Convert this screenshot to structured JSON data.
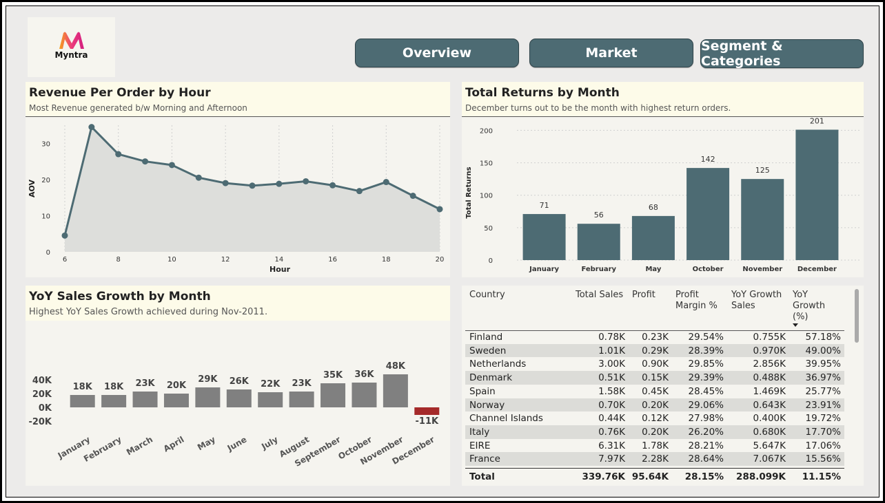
{
  "brand": {
    "name": "Myntra"
  },
  "nav": {
    "overview": "Overview",
    "market": "Market",
    "segment": "Segment & Categories"
  },
  "revenue_panel": {
    "title": "Revenue Per Order by Hour",
    "subtitle": "Most Revenue generated b/w Morning and Afternoon"
  },
  "returns_panel": {
    "title": "Total Returns by Month",
    "subtitle": "December turns  out to be the month with highest return orders."
  },
  "yoy_panel": {
    "title": "YoY Sales Growth by Month",
    "subtitle": "Highest YoY Sales Growth achieved during Nov-2011."
  },
  "chart_data": [
    {
      "type": "area",
      "title": "Revenue Per Order by Hour",
      "xlabel": "Hour",
      "ylabel": "AOV",
      "x": [
        6,
        7,
        8,
        9,
        10,
        11,
        12,
        13,
        14,
        15,
        16,
        17,
        18,
        19,
        20
      ],
      "values": [
        4.5,
        34.5,
        27,
        25,
        24,
        20.5,
        19,
        18.3,
        18.8,
        19.5,
        18.4,
        16.8,
        19.3,
        15.5,
        11.8
      ],
      "xticks": [
        6,
        8,
        10,
        12,
        14,
        16,
        18,
        20
      ],
      "yticks": [
        0,
        10,
        20,
        30
      ],
      "ylim": [
        0,
        35
      ],
      "xlim": [
        6,
        20
      ],
      "color": "#4d6b73"
    },
    {
      "type": "bar",
      "title": "Total Returns by Month",
      "ylabel": "Total Returns",
      "categories": [
        "January",
        "February",
        "May",
        "October",
        "November",
        "December"
      ],
      "values": [
        71,
        56,
        68,
        142,
        125,
        201
      ],
      "yticks": [
        0,
        50,
        100,
        150,
        200
      ],
      "ylim": [
        0,
        210
      ],
      "color": "#4d6b73"
    },
    {
      "type": "bar",
      "title": "YoY Sales Growth by Month",
      "categories": [
        "January",
        "February",
        "March",
        "April",
        "May",
        "June",
        "July",
        "August",
        "September",
        "October",
        "November",
        "December"
      ],
      "values": [
        18,
        18,
        23,
        20,
        29,
        26,
        22,
        23,
        35,
        36,
        48,
        -11
      ],
      "labels": [
        "18K",
        "18K",
        "23K",
        "20K",
        "29K",
        "26K",
        "22K",
        "23K",
        "35K",
        "36K",
        "48K",
        "-11K"
      ],
      "yticks": [
        "40K",
        "20K",
        "0K",
        "-20K"
      ],
      "ytick_values": [
        40,
        20,
        0,
        -20
      ],
      "ylim": [
        -20,
        50
      ],
      "color": "#808080",
      "negative_color": "#a52a2a"
    },
    {
      "type": "table",
      "columns": [
        "Country",
        "Total Sales",
        "Profit",
        "Profit Margin %",
        "YoY Growth Sales",
        "YoY Growth (%)"
      ],
      "rows": [
        [
          "Finland",
          "0.78K",
          "0.23K",
          "29.54%",
          "0.755K",
          "57.18%"
        ],
        [
          "Sweden",
          "1.01K",
          "0.29K",
          "28.39%",
          "0.970K",
          "49.00%"
        ],
        [
          "Netherlands",
          "3.00K",
          "0.90K",
          "29.85%",
          "2.856K",
          "39.95%"
        ],
        [
          "Denmark",
          "0.51K",
          "0.15K",
          "29.39%",
          "0.488K",
          "36.97%"
        ],
        [
          "Spain",
          "1.58K",
          "0.45K",
          "28.45%",
          "1.469K",
          "25.77%"
        ],
        [
          "Norway",
          "0.70K",
          "0.20K",
          "29.06%",
          "0.643K",
          "23.91%"
        ],
        [
          "Channel Islands",
          "0.44K",
          "0.12K",
          "27.98%",
          "0.400K",
          "19.72%"
        ],
        [
          "Italy",
          "0.76K",
          "0.20K",
          "26.20%",
          "0.680K",
          "17.70%"
        ],
        [
          "EIRE",
          "6.31K",
          "1.78K",
          "28.21%",
          "5.647K",
          "17.06%"
        ],
        [
          "France",
          "7.97K",
          "2.28K",
          "28.64%",
          "7.067K",
          "15.56%"
        ]
      ],
      "total": [
        "Total",
        "339.76K",
        "95.64K",
        "28.15%",
        "288.099K",
        "11.15%"
      ],
      "sorted_by": "YoY Growth (%)",
      "sort_direction": "descending"
    }
  ]
}
